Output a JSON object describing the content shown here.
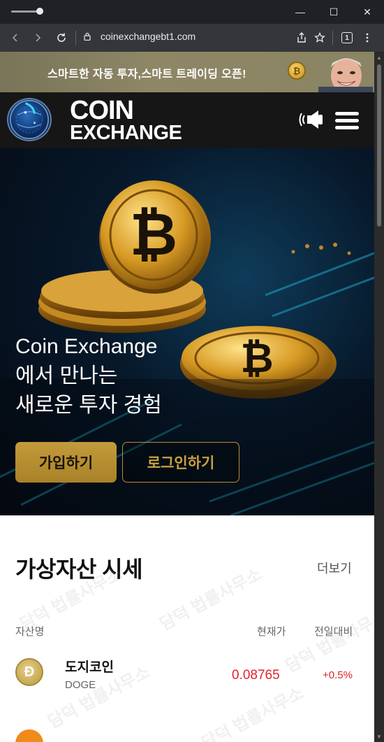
{
  "browser": {
    "url": "coinexchangebt1.com",
    "tab_count": "1",
    "window_controls": {
      "minimize": "—",
      "maximize": "☐",
      "close": "✕"
    }
  },
  "promo": {
    "text": "스마트한 자동 투자,스마트 트레이딩 오픈!",
    "coin_symbol": "₿"
  },
  "header": {
    "logo_title": "COIN",
    "logo_subtitle": "EXCHANGE",
    "icons": [
      "speaker-icon",
      "menu-icon"
    ]
  },
  "hero": {
    "line1": "Coin Exchange",
    "line2": "에서 만나는",
    "line3": "새로운 투자 경험",
    "join_label": "가입하기",
    "login_label": "로그인하기"
  },
  "prices": {
    "title": "가상자산 시세",
    "more_label": "더보기",
    "columns": [
      "자산명",
      "현재가",
      "전일대비"
    ],
    "rows": [
      {
        "name": "도지코인",
        "symbol": "DOGE",
        "price": "0.08765",
        "change": "+0.5%",
        "icon": "doge-icon"
      }
    ]
  },
  "watermark": "담덕 법률사무소",
  "colors": {
    "gold": "#b88e2f",
    "up_red": "#e0242e",
    "header_bg": "#161616"
  }
}
